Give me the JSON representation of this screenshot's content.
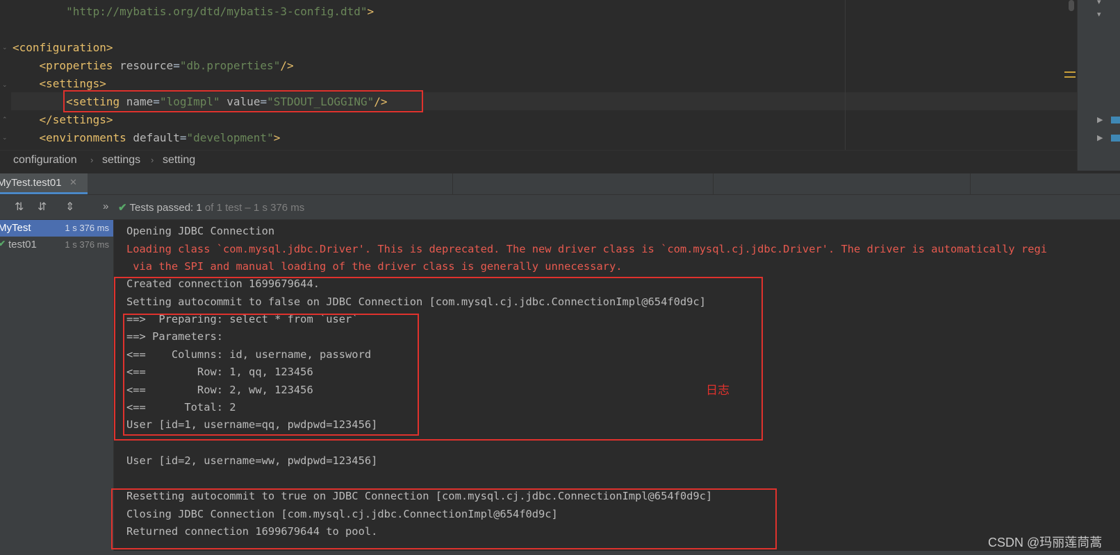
{
  "editor": {
    "lines": [
      {
        "parts": [
          {
            "t": "        ",
            "c": ""
          },
          {
            "t": "\"http://mybatis.org/dtd/mybatis-3-config.dtd\"",
            "c": "str"
          },
          {
            "t": ">",
            "c": "tag"
          }
        ]
      },
      {
        "parts": []
      },
      {
        "parts": [
          {
            "t": "<configuration>",
            "c": "tag"
          }
        ]
      },
      {
        "parts": [
          {
            "t": "    ",
            "c": ""
          },
          {
            "t": "<properties ",
            "c": "tag"
          },
          {
            "t": "resource",
            "c": "attr"
          },
          {
            "t": "=",
            "c": ""
          },
          {
            "t": "\"db.properties\"",
            "c": "val"
          },
          {
            "t": "/>",
            "c": "tag"
          }
        ]
      },
      {
        "parts": [
          {
            "t": "    ",
            "c": ""
          },
          {
            "t": "<settings>",
            "c": "tag"
          }
        ]
      },
      {
        "parts": [
          {
            "t": "        ",
            "c": ""
          },
          {
            "t": "<setting ",
            "c": "tag"
          },
          {
            "t": "name",
            "c": "attr"
          },
          {
            "t": "=",
            "c": ""
          },
          {
            "t": "\"logImpl\"",
            "c": "val"
          },
          {
            "t": " ",
            "c": ""
          },
          {
            "t": "value",
            "c": "attr"
          },
          {
            "t": "=",
            "c": ""
          },
          {
            "t": "\"STDOUT_LOGGING\"",
            "c": "val"
          },
          {
            "t": "/>",
            "c": "tag"
          }
        ]
      },
      {
        "parts": [
          {
            "t": "    ",
            "c": ""
          },
          {
            "t": "</settings>",
            "c": "tag"
          }
        ]
      },
      {
        "parts": [
          {
            "t": "    ",
            "c": ""
          },
          {
            "t": "<environments ",
            "c": "tag"
          },
          {
            "t": "default",
            "c": "attr"
          },
          {
            "t": "=",
            "c": ""
          },
          {
            "t": "\"development\"",
            "c": "val"
          },
          {
            "t": ">",
            "c": "tag"
          }
        ]
      }
    ]
  },
  "breadcrumb": {
    "items": [
      "configuration",
      "settings",
      "setting"
    ]
  },
  "run_tab": {
    "label": "MyTest.test01",
    "close_icon": "close-icon"
  },
  "toolbar": {
    "status_label": "Tests passed:",
    "status_count": "1",
    "status_detail": "of 1 test – 1 s 376 ms",
    "expand_glyph": "»"
  },
  "test_tree": {
    "items": [
      {
        "name": "MyTest",
        "time": "1 s 376 ms"
      },
      {
        "name": "test01",
        "time": "1 s 376 ms"
      }
    ]
  },
  "console": {
    "lines": [
      {
        "text": "Opening JDBC Connection",
        "err": false
      },
      {
        "text": "Loading class `com.mysql.jdbc.Driver'. This is deprecated. The new driver class is `com.mysql.cj.jdbc.Driver'. The driver is automatically regi",
        "err": true
      },
      {
        "text": " via the SPI and manual loading of the driver class is generally unnecessary.",
        "err": true
      },
      {
        "text": "Created connection 1699679644.",
        "err": false
      },
      {
        "text": "Setting autocommit to false on JDBC Connection [com.mysql.cj.jdbc.ConnectionImpl@654f0d9c]",
        "err": false
      },
      {
        "text": "==>  Preparing: select * from `user`",
        "err": false
      },
      {
        "text": "==> Parameters: ",
        "err": false
      },
      {
        "text": "<==    Columns: id, username, password",
        "err": false
      },
      {
        "text": "<==        Row: 1, qq, 123456",
        "err": false
      },
      {
        "text": "<==        Row: 2, ww, 123456",
        "err": false
      },
      {
        "text": "<==      Total: 2",
        "err": false
      },
      {
        "text": "User [id=1, username=qq, pwdpwd=123456]",
        "err": false
      },
      {
        "text": "",
        "err": false
      },
      {
        "text": "User [id=2, username=ww, pwdpwd=123456]",
        "err": false
      },
      {
        "text": "",
        "err": false
      },
      {
        "text": "Resetting autocommit to true on JDBC Connection [com.mysql.cj.jdbc.ConnectionImpl@654f0d9c]",
        "err": false
      },
      {
        "text": "Closing JDBC Connection [com.mysql.cj.jdbc.ConnectionImpl@654f0d9c]",
        "err": false
      },
      {
        "text": "Returned connection 1699679644 to pool.",
        "err": false
      }
    ]
  },
  "annotation": {
    "note": "日志"
  },
  "watermark": "CSDN @玛丽莲茼蒿",
  "colors": {
    "highlight_box": "#e0322d",
    "error_text": "#e85a4f",
    "selection": "#4b6eaf",
    "pass_check": "#59a869"
  }
}
